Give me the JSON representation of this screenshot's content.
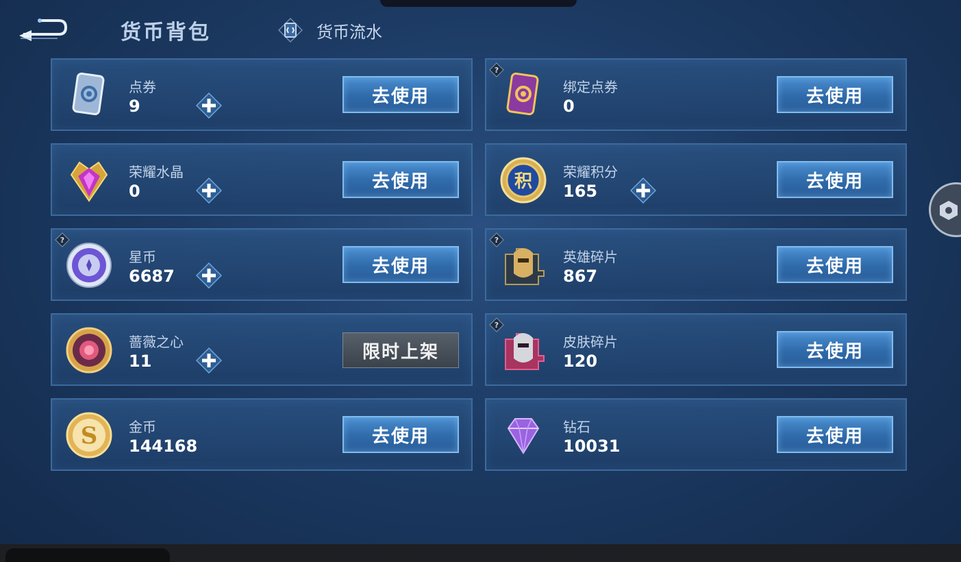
{
  "header": {
    "title": "货币背包",
    "flow_link": "货币流水"
  },
  "currencies": [
    {
      "name": "点券",
      "amount": "9",
      "plus": true,
      "help": false,
      "button": "去使用",
      "icon": "voucher-card-icon"
    },
    {
      "name": "绑定点券",
      "amount": "0",
      "plus": false,
      "help": true,
      "button": "去使用",
      "icon": "bound-voucher-card-icon"
    },
    {
      "name": "荣耀水晶",
      "amount": "0",
      "plus": true,
      "help": false,
      "button": "去使用",
      "icon": "glory-crystal-icon"
    },
    {
      "name": "荣耀积分",
      "amount": "165",
      "plus": true,
      "help": false,
      "button": "去使用",
      "icon": "glory-points-icon"
    },
    {
      "name": "星币",
      "amount": "6687",
      "plus": true,
      "help": true,
      "button": "去使用",
      "icon": "star-coin-icon"
    },
    {
      "name": "英雄碎片",
      "amount": "867",
      "plus": false,
      "help": true,
      "button": "去使用",
      "icon": "hero-fragment-icon"
    },
    {
      "name": "蔷薇之心",
      "amount": "11",
      "plus": true,
      "help": false,
      "button": "限时上架",
      "icon": "rose-heart-icon"
    },
    {
      "name": "皮肤碎片",
      "amount": "120",
      "plus": false,
      "help": true,
      "button": "去使用",
      "icon": "skin-fragment-icon"
    },
    {
      "name": "金币",
      "amount": "144168",
      "plus": false,
      "help": false,
      "button": "去使用",
      "icon": "gold-coin-icon"
    },
    {
      "name": "钻石",
      "amount": "10031",
      "plus": false,
      "help": false,
      "button": "去使用",
      "icon": "diamond-icon"
    }
  ],
  "colors": {
    "background": "#1c3a63",
    "panel_border": "#3d6a9c",
    "button_blue": "#2f6aaa",
    "button_gray": "#3a424b"
  }
}
